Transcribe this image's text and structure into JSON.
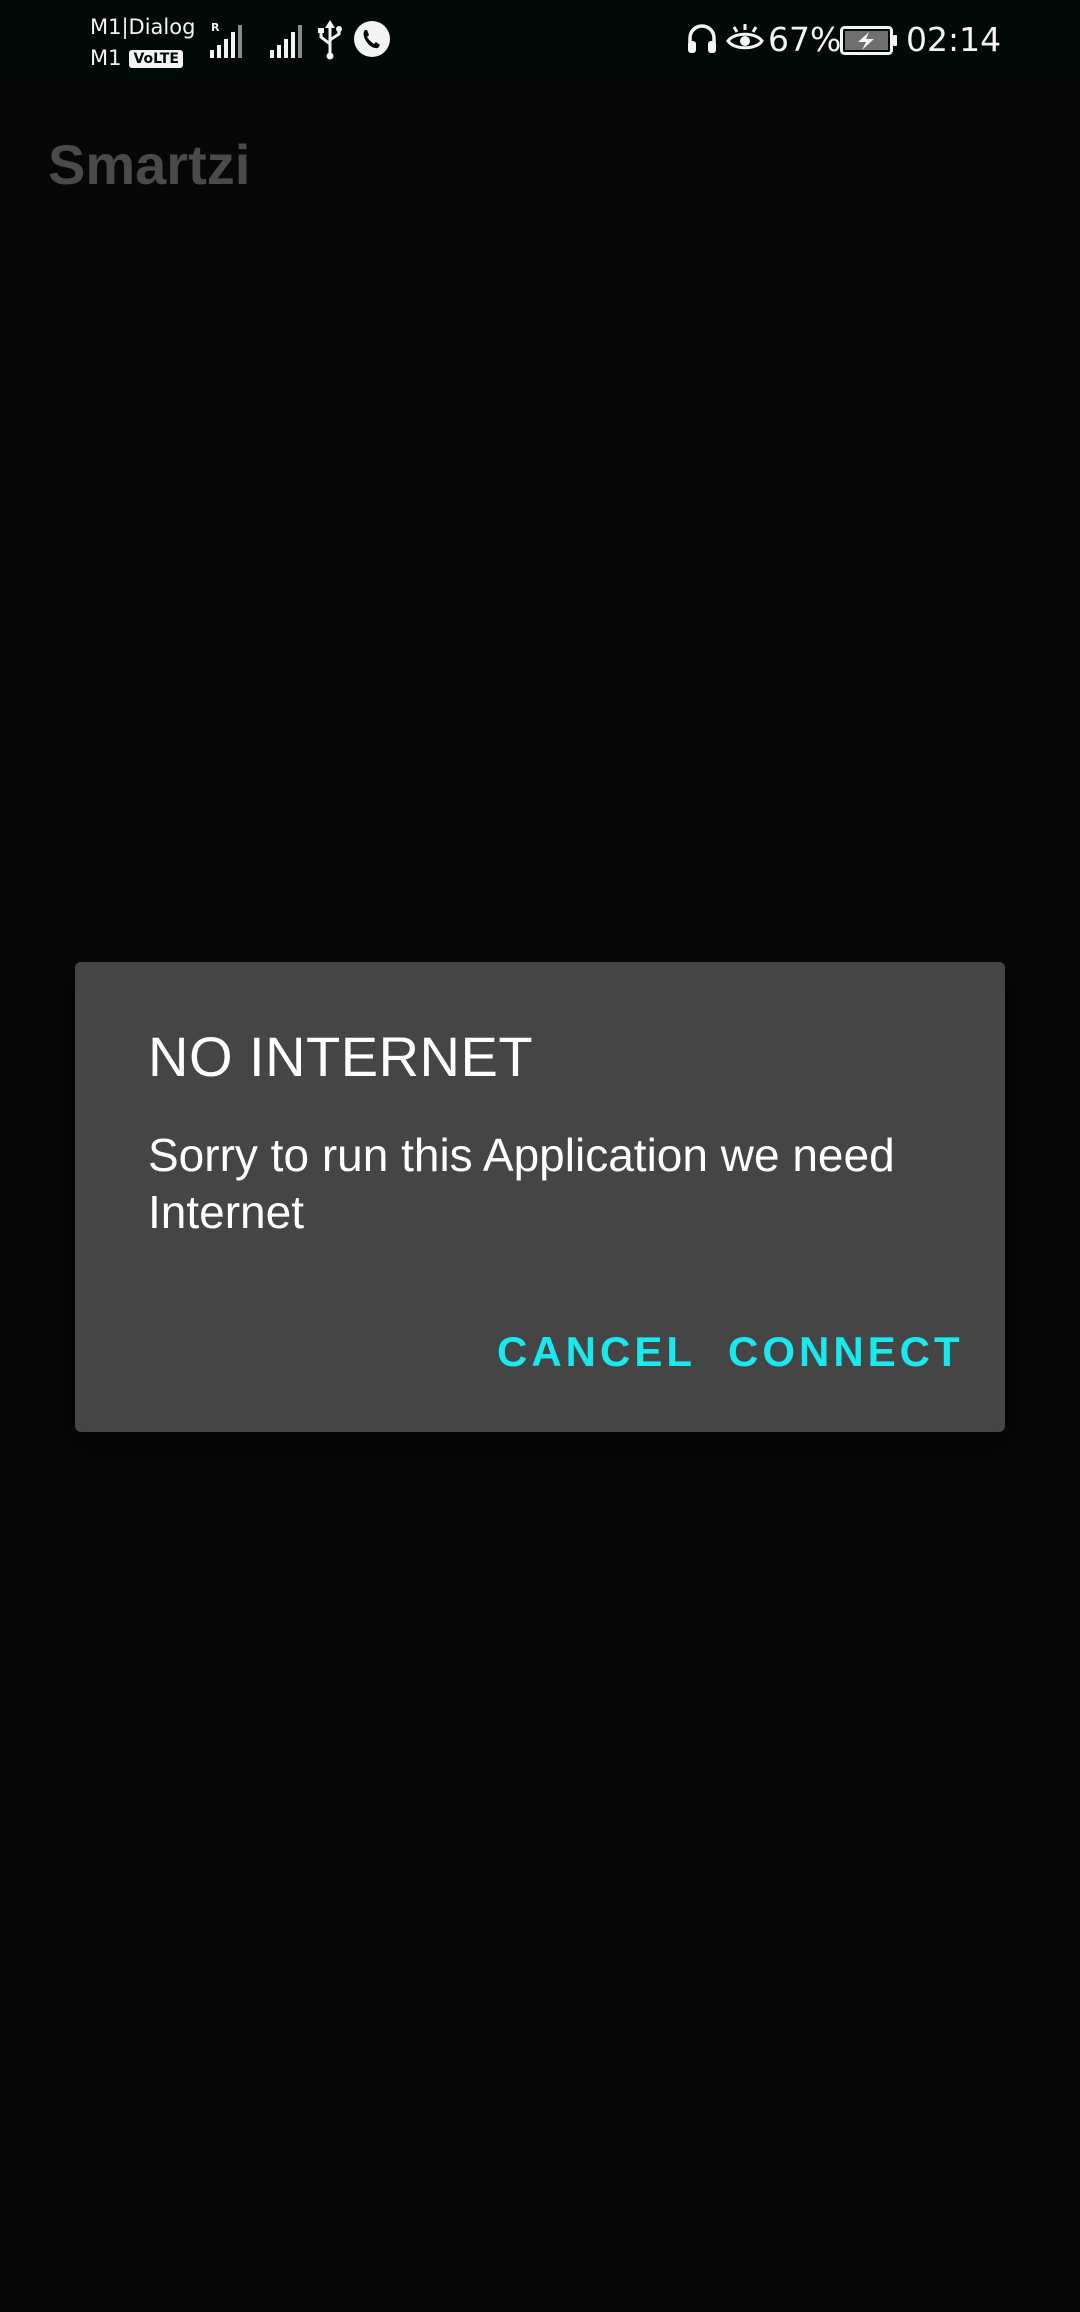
{
  "status_bar": {
    "carrier_top": "M1|Dialog",
    "carrier_bottom": "M1",
    "volte_badge": "VoLTE",
    "roaming_indicator": "R",
    "battery_percent": "67%",
    "time": "02:14",
    "icons": [
      "signal-icon",
      "signal-icon",
      "usb-icon",
      "call-icon",
      "headset-icon",
      "eye-icon",
      "battery-charging-icon"
    ]
  },
  "app_bar": {
    "title": "Smartzi"
  },
  "dialog": {
    "title": "NO INTERNET",
    "message": "Sorry to run this Application we need Internet",
    "cancel_label": "CANCEL",
    "connect_label": "CONNECT"
  },
  "colors": {
    "background": "#070707",
    "dialog_background": "#454545",
    "accent": "#19e8ee",
    "title_dim": "#4a4a4a"
  }
}
